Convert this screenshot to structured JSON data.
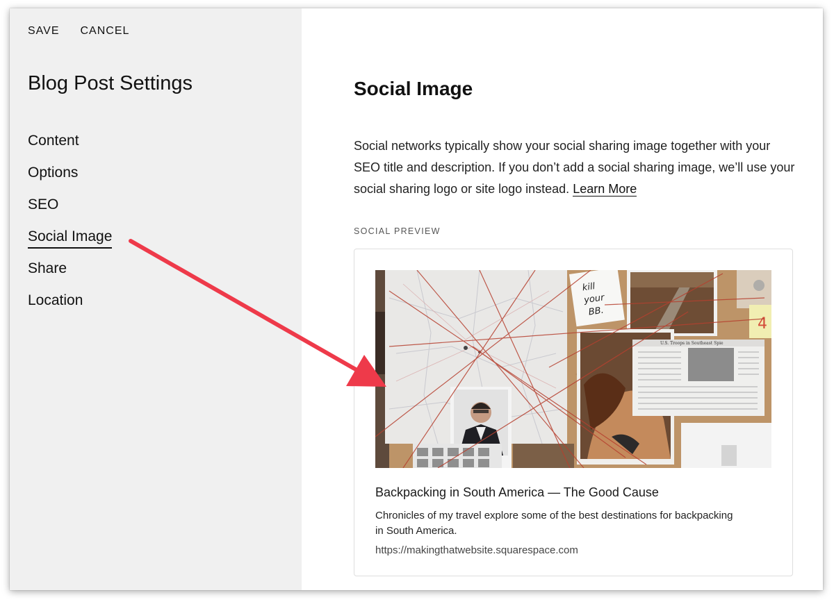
{
  "toolbar": {
    "save_label": "SAVE",
    "cancel_label": "CANCEL"
  },
  "sidebar": {
    "title": "Blog Post Settings",
    "items": [
      {
        "label": "Content"
      },
      {
        "label": "Options"
      },
      {
        "label": "SEO"
      },
      {
        "label": "Social Image",
        "active": true
      },
      {
        "label": "Share"
      },
      {
        "label": "Location"
      }
    ]
  },
  "main": {
    "title": "Social Image",
    "description": "Social networks typically show your social sharing image together with your SEO title and description. If you don’t add a social sharing image, we’ll use your social sharing logo or site logo instead.",
    "learn_more": "Learn More",
    "section_label": "SOCIAL PREVIEW",
    "preview": {
      "title": "Backpacking in South America — The Good Cause",
      "description": "Chronicles of my travel explore some of the best destinations for backpacking in South America.",
      "url": "https://makingthatwebsite.squarespace.com"
    }
  },
  "colors": {
    "sidebar_bg": "#f0f0f0",
    "arrow": "#ee3a4a",
    "string": "#b6402f"
  }
}
